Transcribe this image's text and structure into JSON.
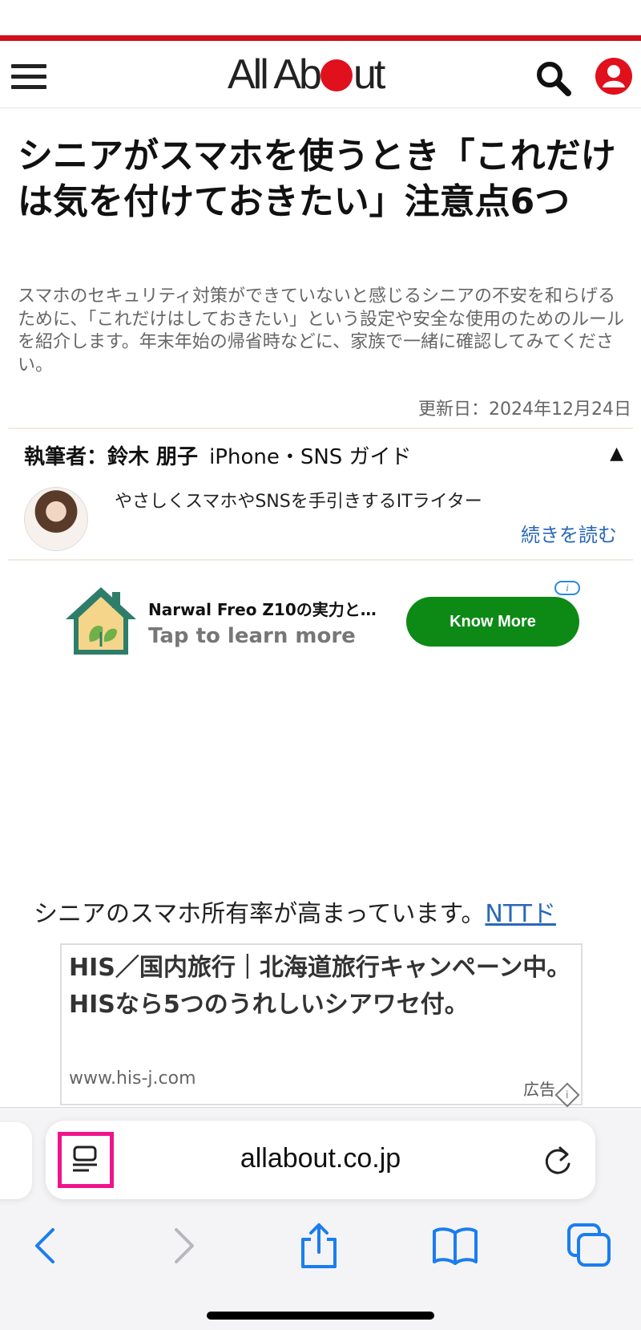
{
  "header": {
    "logo_left": "All Ab",
    "logo_right": "ut",
    "colors": {
      "brand_red": "#d0101a"
    }
  },
  "article": {
    "title": "シニアがスマホを使うとき「これだけは気を付けておきたい」注意点6つ",
    "lead": "スマホのセキュリティ対策ができていないと感じるシニアの不安を和らげるために、「これだけはしておきたい」という設定や安全な使用のためのルールを紹介します。年末年始の帰省時などに、家族で一緒に確認してみてください。",
    "updated": "更新日：2024年12月24日"
  },
  "author": {
    "name_label": "執筆者：鈴木 朋子",
    "guide": "iPhone・SNS ガイド",
    "collapse_symbol": "▲",
    "description": "やさしくスマホやSNSを手引きするITライター",
    "read_more": "続きを読む"
  },
  "banner_ad": {
    "title": "Narwal Freo Z10の実力と…",
    "subtitle": "Tap to learn more",
    "cta": "Know More",
    "info_symbol": "i"
  },
  "body": {
    "text": "シニアのスマホ所有率が高まっています。",
    "link": "NTTド"
  },
  "text_ad": {
    "title": "HIS／国内旅行｜北海道旅行キャンペーン中。HISなら5つのうれしいシアワセ付。",
    "url": "www.his-j.com",
    "label": "広告",
    "info_symbol": "i"
  },
  "browser": {
    "url": "allabout.co.jp",
    "highlight_color": "#f0148c",
    "icons": [
      "reader-icon",
      "reload-icon",
      "back-icon",
      "forward-icon",
      "share-icon",
      "bookmarks-icon",
      "tabs-icon"
    ]
  }
}
